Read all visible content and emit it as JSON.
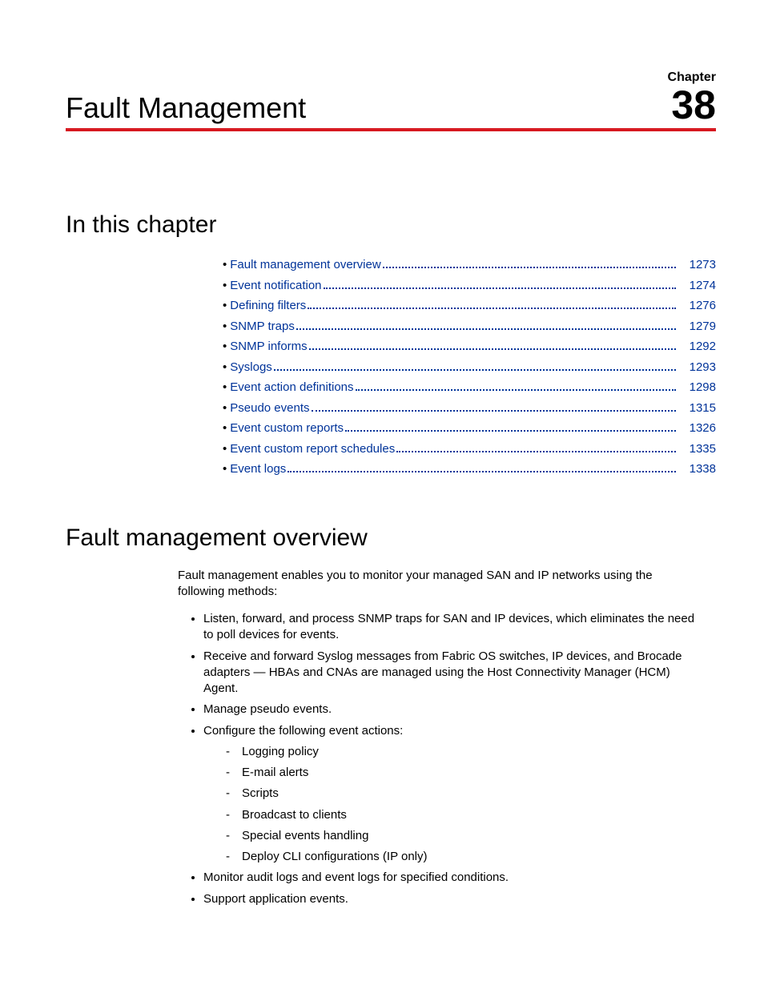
{
  "header": {
    "title": "Fault Management",
    "chapter_label": "Chapter",
    "chapter_number": "38"
  },
  "toc": {
    "heading": "In this chapter",
    "items": [
      {
        "label": "Fault management overview",
        "page": "1273"
      },
      {
        "label": "Event notification",
        "page": "1274"
      },
      {
        "label": "Defining filters",
        "page": "1276"
      },
      {
        "label": "SNMP traps",
        "page": "1279"
      },
      {
        "label": "SNMP informs",
        "page": "1292"
      },
      {
        "label": "Syslogs",
        "page": "1293"
      },
      {
        "label": "Event action definitions",
        "page": "1298"
      },
      {
        "label": "Pseudo events",
        "page": "1315"
      },
      {
        "label": "Event custom reports",
        "page": "1326"
      },
      {
        "label": "Event custom report schedules",
        "page": "1335"
      },
      {
        "label": "Event logs",
        "page": "1338"
      }
    ]
  },
  "overview": {
    "heading": "Fault management overview",
    "intro": "Fault management enables you to monitor your managed SAN and IP networks using the following methods:",
    "bullets": [
      "Listen, forward, and process SNMP traps for SAN and IP devices, which eliminates the need to poll devices for events.",
      "Receive and forward Syslog messages from Fabric OS switches, IP devices, and Brocade adapters — HBAs and CNAs are managed using the Host Connectivity Manager (HCM) Agent.",
      "Manage pseudo events.",
      "Configure the following event actions:"
    ],
    "sub_bullets": [
      "Logging policy",
      "E-mail alerts",
      "Scripts",
      "Broadcast to clients",
      "Special events handling",
      "Deploy CLI configurations (IP only)"
    ],
    "bullets_after": [
      "Monitor audit logs and event logs for specified conditions.",
      "Support application events."
    ]
  }
}
